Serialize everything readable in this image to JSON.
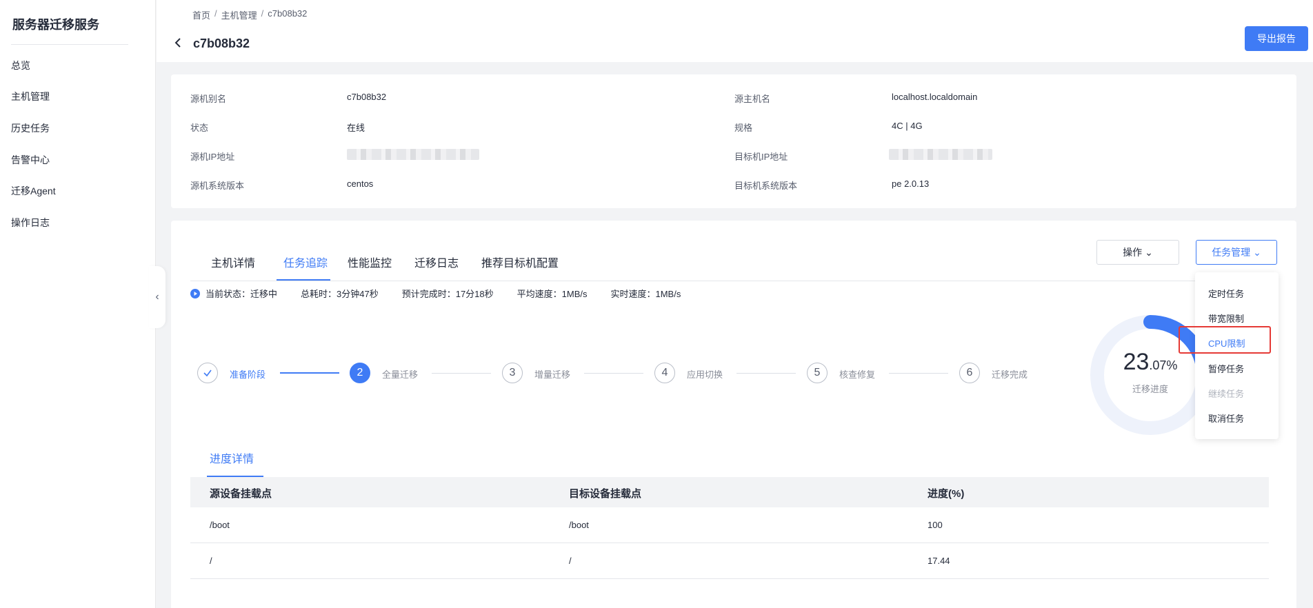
{
  "sidebar": {
    "title": "服务器迁移服务",
    "items": [
      "总览",
      "主机管理",
      "历史任务",
      "告警中心",
      "迁移Agent",
      "操作日志"
    ]
  },
  "header": {
    "breadcrumb": [
      "首页",
      "主机管理",
      "c7b08b32"
    ],
    "separator": "/",
    "title": "c7b08b32",
    "export_label": "导出报告"
  },
  "info": {
    "source_alias_label": "源机别名",
    "source_alias": "c7b08b32",
    "status_label": "状态",
    "status": "在线",
    "source_ip_label": "源机IP地址",
    "source_os_label": "源机系统版本",
    "source_os": "centos",
    "source_host_label": "源主机名",
    "source_host": "localhost.localdomain",
    "spec_label": "规格",
    "spec": "4C | 4G",
    "target_ip_label": "目标机IP地址",
    "target_os_label": "目标机系统版本",
    "target_os": "pe 2.0.13"
  },
  "tabs": [
    "主机详情",
    "任务追踪",
    "性能监控",
    "迁移日志",
    "推荐目标机配置"
  ],
  "active_tab": "任务追踪",
  "actions": {
    "operate_label": "操作",
    "task_manage_label": "任务管理"
  },
  "status": {
    "current": "当前状态：迁移中",
    "elapsed": "总耗时：3分钟47秒",
    "eta": "预计完成时：17分18秒",
    "avg_speed": "平均速度：1MB/s",
    "realtime_speed": "实时速度：1MB/s"
  },
  "steps": [
    {
      "num": "",
      "label": "准备阶段",
      "state": "done"
    },
    {
      "num": "2",
      "label": "全量迁移",
      "state": "active"
    },
    {
      "num": "3",
      "label": "增量迁移",
      "state": "pending"
    },
    {
      "num": "4",
      "label": "应用切换",
      "state": "pending"
    },
    {
      "num": "5",
      "label": "核查修复",
      "state": "pending"
    },
    {
      "num": "6",
      "label": "迁移完成",
      "state": "pending"
    }
  ],
  "progress": {
    "int_part": "23",
    "dec_part": ".07%",
    "caption": "迁移进度",
    "fraction": 0.2307
  },
  "details": {
    "subtab": "进度详情",
    "columns": [
      "源设备挂载点",
      "目标设备挂载点",
      "进度(%)"
    ],
    "rows": [
      [
        "/boot",
        "/boot",
        "100"
      ],
      [
        "/",
        "/",
        "17.44"
      ]
    ]
  },
  "dropdown": {
    "items": [
      "定时任务",
      "带宽限制",
      "CPU限制",
      "暂停任务",
      "继续任务",
      "取消任务"
    ],
    "highlighted": "CPU限制",
    "disabled": "继续任务"
  },
  "colors": {
    "accent": "#3f7bf5",
    "highlight_box": "#e53935"
  }
}
